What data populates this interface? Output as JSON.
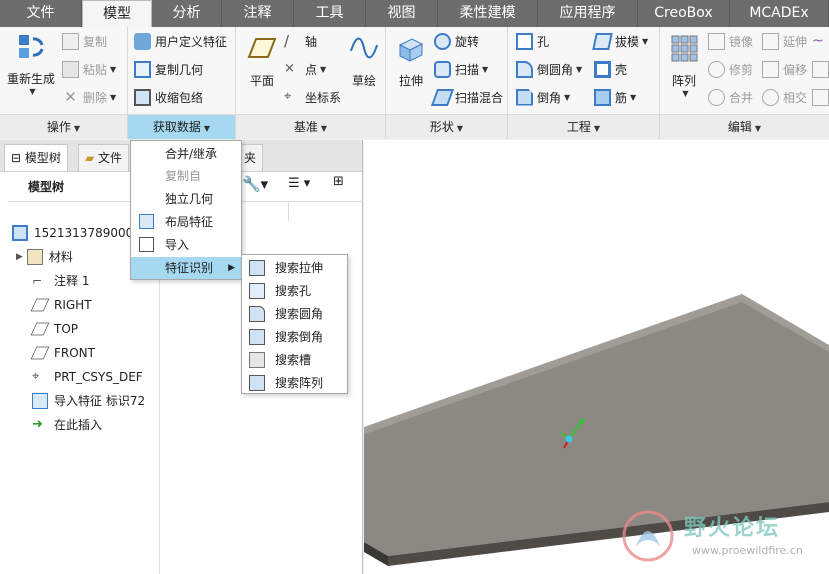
{
  "tabs": [
    "文件",
    "模型",
    "分析",
    "注释",
    "工具",
    "视图",
    "柔性建模",
    "应用程序",
    "CreoBox",
    "MCADEx"
  ],
  "groups": {
    "ops": {
      "title": "操作",
      "regen": "重新生成",
      "copy": "复制",
      "paste": "粘贴",
      "delete": "删除"
    },
    "getdata": {
      "title": "获取数据",
      "udf": "用户定义特征",
      "copygeom": "复制几何",
      "shrinkwrap": "收缩包络"
    },
    "datum": {
      "title": "基准",
      "plane": "平面",
      "axis": "轴",
      "point": "点",
      "csys": "坐标系",
      "sketch": "草绘"
    },
    "shape": {
      "title": "形状",
      "extrude": "拉伸",
      "revolve": "旋转",
      "sweep": "扫描",
      "swept_blend": "扫描混合"
    },
    "eng": {
      "title": "工程",
      "hole": "孔",
      "round": "倒圆角",
      "chamfer": "倒角",
      "draft": "拔模",
      "shell": "壳",
      "rib": "筋"
    },
    "edit": {
      "title": "编辑",
      "pattern": "阵列",
      "mirror": "镜像",
      "extend": "延伸",
      "trim": "修剪",
      "offset": "偏移",
      "merge": "合并",
      "intersect": "相交"
    }
  },
  "left": {
    "tab1": "模型树",
    "tab2": "文件",
    "tab3": "夹",
    "header": "模型树"
  },
  "tree": [
    "1521313789000E",
    "材料",
    "注释 1",
    "RIGHT",
    "TOP",
    "FRONT",
    "PRT_CSYS_DEF",
    "导入特征 标识72",
    "在此插入"
  ],
  "menu1": [
    "合并/继承",
    "复制自",
    "独立几何",
    "布局特征",
    "导入",
    "特征识别"
  ],
  "menu2": [
    "搜索拉伸",
    "搜索孔",
    "搜索圆角",
    "搜索倒角",
    "搜索槽",
    "搜索阵列"
  ],
  "watermark": {
    "title": "野火论坛",
    "url": "www.proewildfire.cn"
  },
  "colors": {
    "plate_top": "#7d7a74",
    "plate_side": "#55524d",
    "highlight": "#a6d8f2",
    "tabbar": "#6d6d6d"
  }
}
